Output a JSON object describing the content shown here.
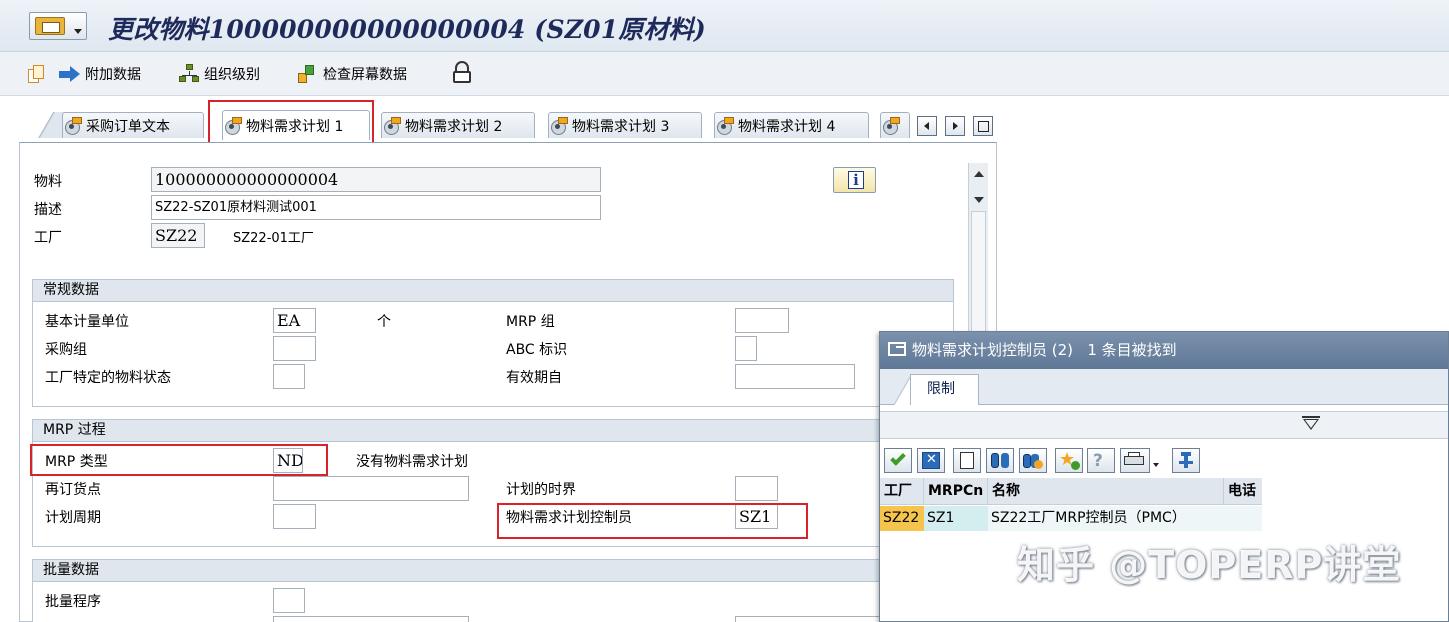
{
  "title": {
    "text": "更改物料100000000000000004 (SZ01原材料)"
  },
  "toolbar": {
    "additional_data": "附加数据",
    "org_levels": "组织级别",
    "check_screen_data": "检查屏幕数据"
  },
  "tabs": [
    {
      "label": "采购订单文本",
      "active": false
    },
    {
      "label": "物料需求计划 1",
      "active": true
    },
    {
      "label": "物料需求计划 2",
      "active": false
    },
    {
      "label": "物料需求计划 3",
      "active": false
    },
    {
      "label": "物料需求计划 4",
      "active": false
    }
  ],
  "header": {
    "material_label": "物料",
    "material_value": "100000000000000004",
    "description_label": "描述",
    "description_value": "SZ22-SZ01原材料测试001",
    "plant_label": "工厂",
    "plant_value": "SZ22",
    "plant_name": "SZ22-01工厂"
  },
  "general": {
    "title": "常规数据",
    "base_unit_label": "基本计量单位",
    "base_unit_value": "EA",
    "base_unit_text": "个",
    "purch_group_label": "采购组",
    "plant_status_label": "工厂特定的物料状态",
    "mrp_group_label": "MRP 组",
    "abc_label": "ABC 标识",
    "valid_from_label": "有效期自"
  },
  "mrp": {
    "title": "MRP 过程",
    "mrp_type_label": "MRP 类型",
    "mrp_type_value": "ND",
    "mrp_type_text": "没有物料需求计划",
    "reorder_label": "再订货点",
    "planning_cycle_label": "计划周期",
    "time_fence_label": "计划的时界",
    "controller_label": "物料需求计划控制员",
    "controller_value": "SZ1"
  },
  "lot": {
    "title": "批量数据",
    "procedure_label": "批量程序"
  },
  "popup": {
    "title": "物料需求计划控制员 (2)",
    "found": "1 条目被找到",
    "tab_label": "限制",
    "columns": [
      "工厂",
      "MRPCn",
      "名称",
      "电话"
    ],
    "rows": [
      {
        "plant": "SZ22",
        "mrpcn": "SZ1",
        "name": "SZ22工厂MRP控制员（PMC）",
        "phone": ""
      }
    ]
  },
  "watermark": "知乎 @TOPERP讲堂",
  "colors": {
    "highlight_red": "#d9232a",
    "plant_cell": "#f5c44c",
    "mrpcn_cell": "#d4eef0",
    "title_text": "#1e2a5a"
  }
}
